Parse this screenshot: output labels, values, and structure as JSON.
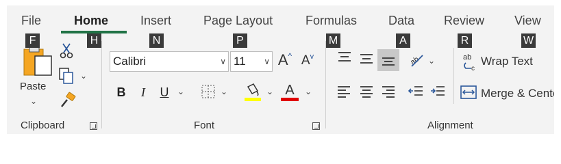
{
  "tabs": {
    "file": "File",
    "home": "Home",
    "insert": "Insert",
    "page_layout": "Page Layout",
    "formulas": "Formulas",
    "data": "Data",
    "review": "Review",
    "view": "View"
  },
  "keytips": {
    "file": "F",
    "home": "H",
    "insert": "N",
    "page_layout": "P",
    "formulas": "M",
    "data": "A",
    "review": "R",
    "view": "W"
  },
  "clipboard": {
    "paste_label": "Paste",
    "group_label": "Clipboard"
  },
  "font": {
    "font_name": "Calibri",
    "font_size": "11",
    "bold": "B",
    "italic": "I",
    "underline": "U",
    "grow_font": "A",
    "shrink_font": "A",
    "font_color_letter": "A",
    "group_label": "Font"
  },
  "alignment": {
    "wrap_text": "Wrap Text",
    "merge_center": "Merge & Center",
    "group_label": "Alignment"
  },
  "colors": {
    "accent": "#217346",
    "highlight": "#ffff00",
    "font_color": "#e00000",
    "keytip_bg": "#3a3a3a",
    "icon_blue": "#2b579a",
    "selected_bg": "#c8c8c8"
  }
}
